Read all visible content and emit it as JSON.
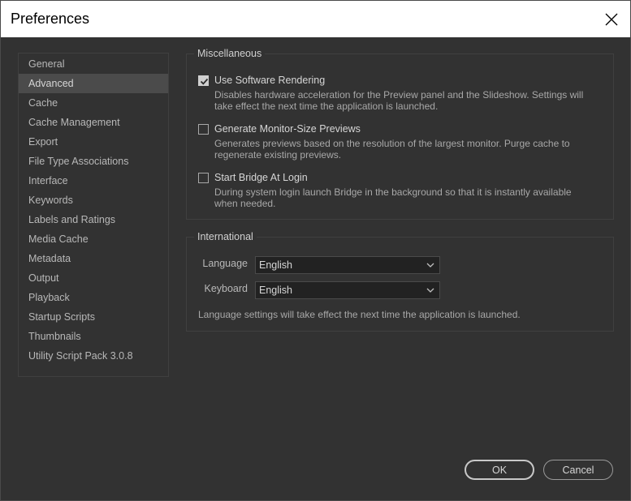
{
  "window": {
    "title": "Preferences",
    "close_icon": "close-icon"
  },
  "sidebar": {
    "items": [
      {
        "label": "General",
        "selected": false
      },
      {
        "label": "Advanced",
        "selected": true
      },
      {
        "label": "Cache",
        "selected": false
      },
      {
        "label": "Cache Management",
        "selected": false
      },
      {
        "label": "Export",
        "selected": false
      },
      {
        "label": "File Type Associations",
        "selected": false
      },
      {
        "label": "Interface",
        "selected": false
      },
      {
        "label": "Keywords",
        "selected": false
      },
      {
        "label": "Labels and Ratings",
        "selected": false
      },
      {
        "label": "Media Cache",
        "selected": false
      },
      {
        "label": "Metadata",
        "selected": false
      },
      {
        "label": "Output",
        "selected": false
      },
      {
        "label": "Playback",
        "selected": false
      },
      {
        "label": "Startup Scripts",
        "selected": false
      },
      {
        "label": "Thumbnails",
        "selected": false
      },
      {
        "label": "Utility Script Pack 3.0.8",
        "selected": false
      }
    ]
  },
  "misc": {
    "title": "Miscellaneous",
    "options": [
      {
        "label": "Use Software Rendering",
        "checked": true,
        "description": "Disables hardware acceleration for the Preview panel and the Slideshow. Settings will take effect the next time the application is launched."
      },
      {
        "label": "Generate Monitor-Size Previews",
        "checked": false,
        "description": "Generates previews based on the resolution of the largest monitor. Purge cache to regenerate existing previews."
      },
      {
        "label": "Start Bridge At Login",
        "checked": false,
        "description": "During system login launch Bridge in the background so that it is instantly available when needed."
      }
    ]
  },
  "international": {
    "title": "International",
    "language_label": "Language",
    "language_value": "English",
    "keyboard_label": "Keyboard",
    "keyboard_value": "English",
    "note": "Language settings will take effect the next time the application is launched."
  },
  "buttons": {
    "ok_label": "OK",
    "cancel_label": "Cancel"
  },
  "colors": {
    "background": "#323232",
    "titlebar": "#ffffff",
    "selected_item": "#4b4b4b",
    "dropdown_bg": "#222222"
  }
}
